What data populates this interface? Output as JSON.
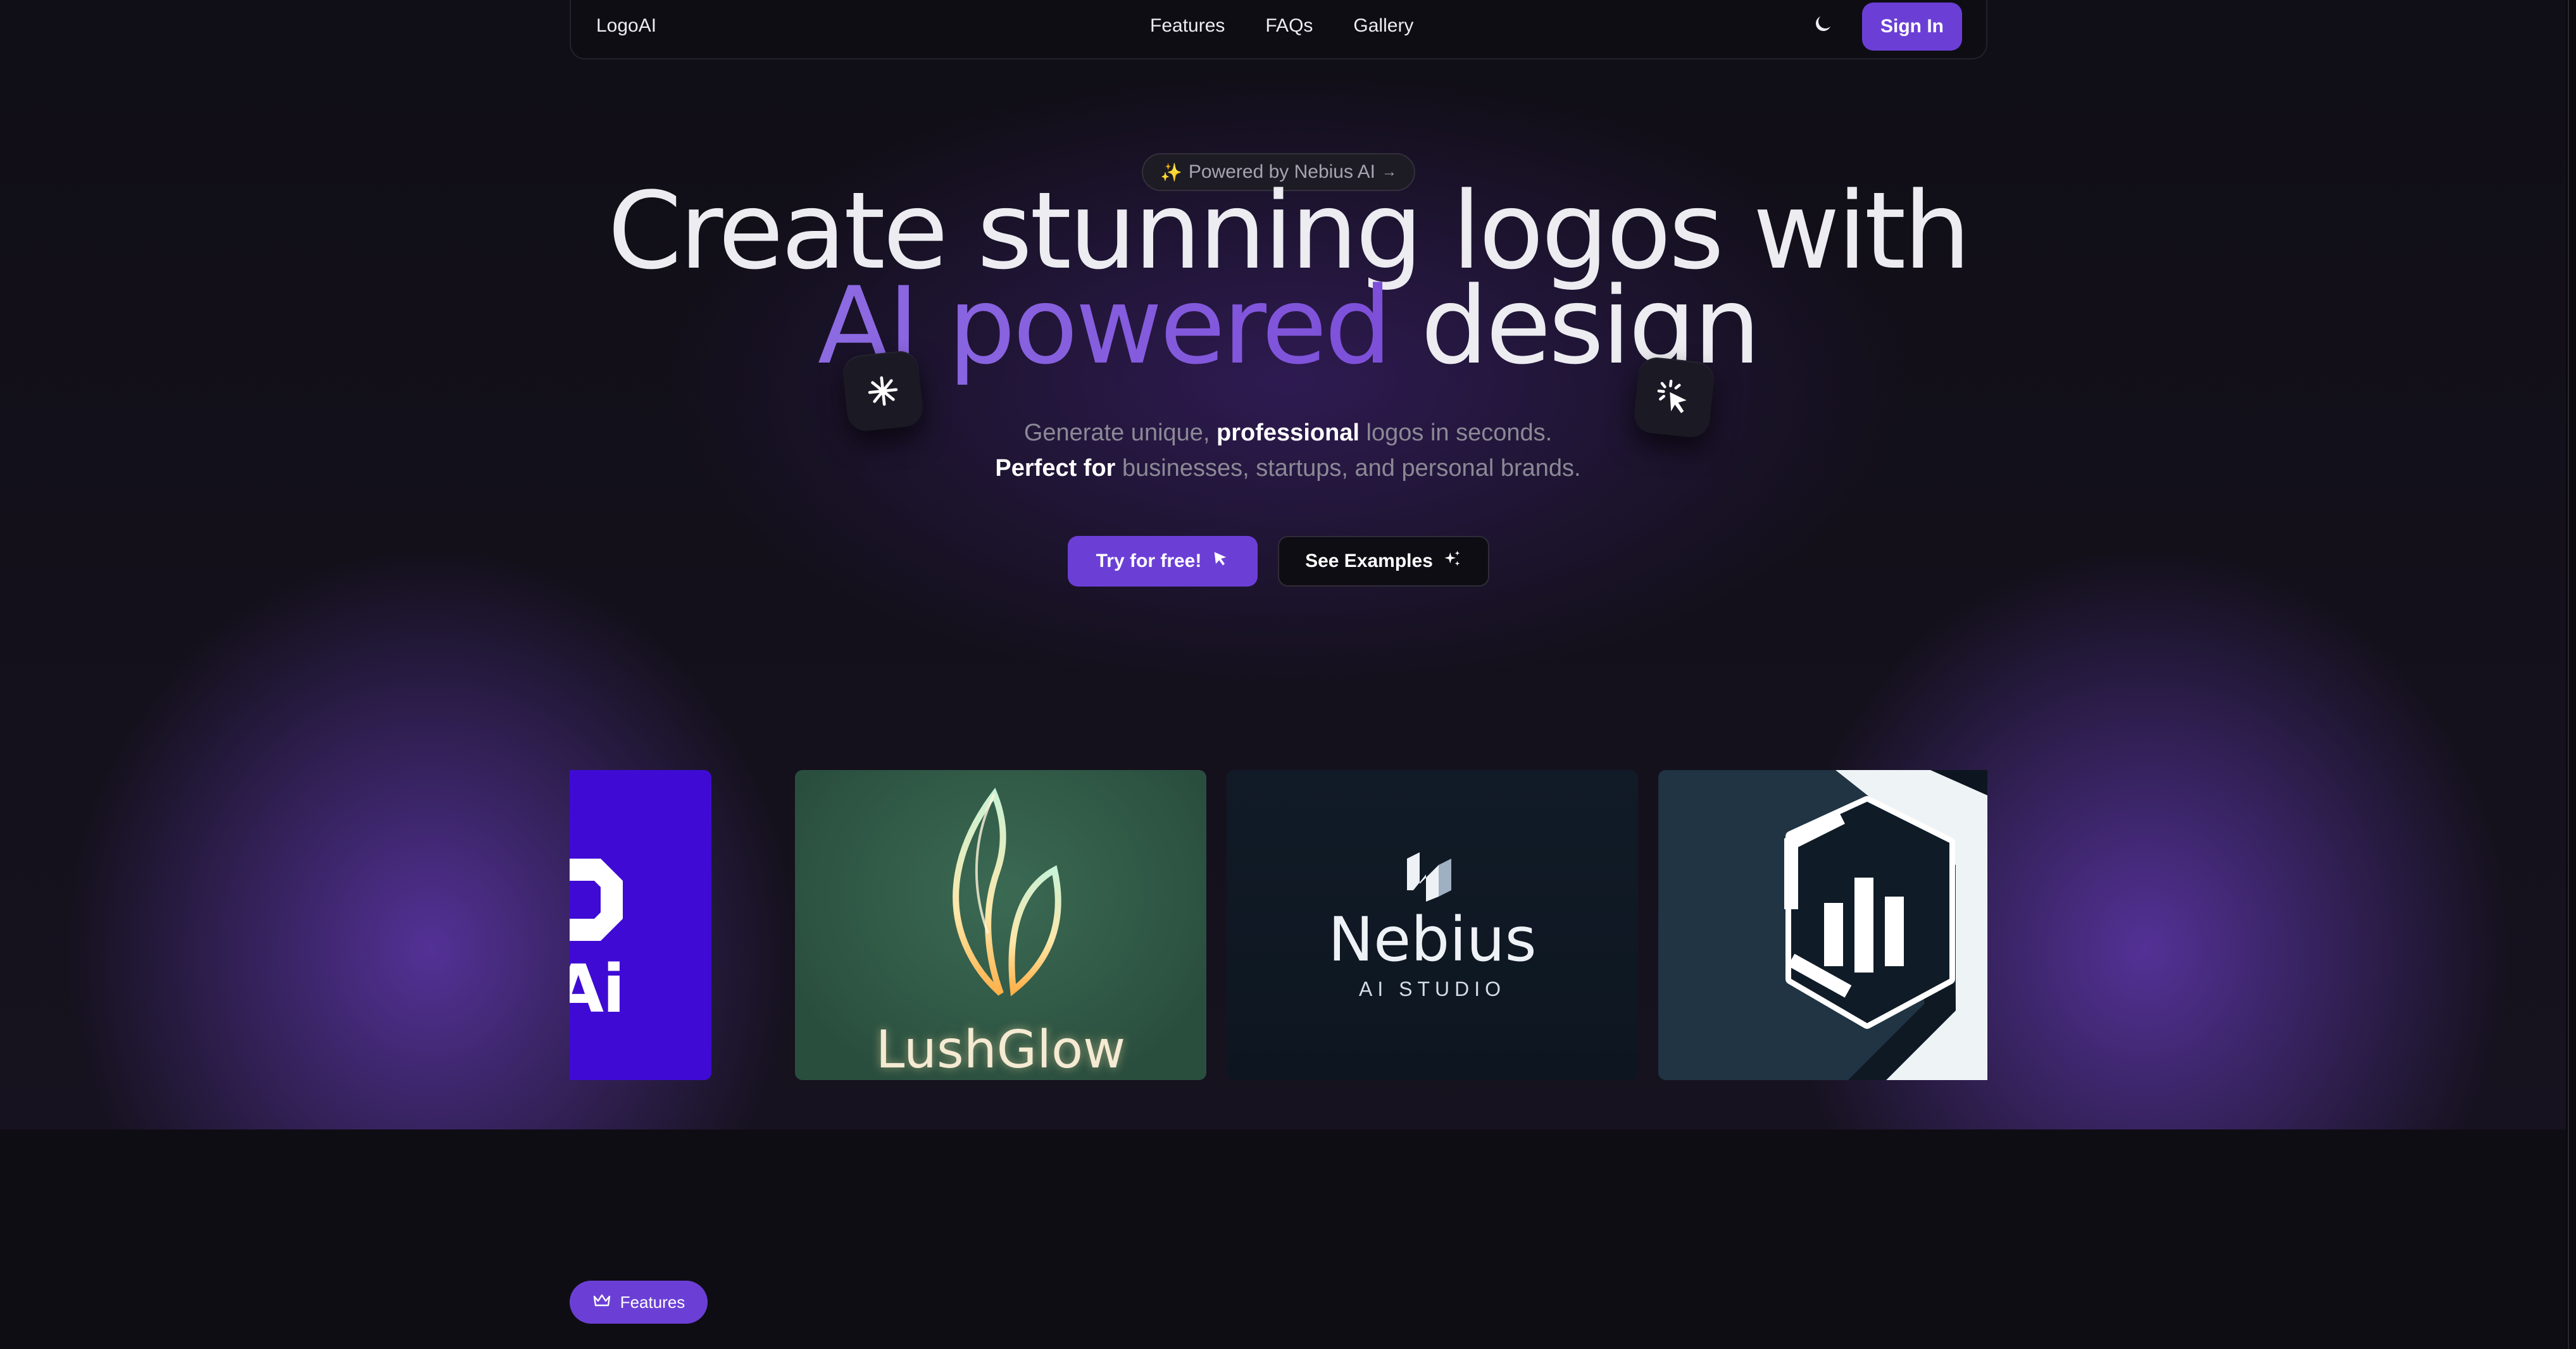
{
  "nav": {
    "brand": "LogoAI",
    "links": [
      "Features",
      "FAQs",
      "Gallery"
    ],
    "theme_toggle_icon": "moon-icon",
    "signin_label": "Sign In"
  },
  "badge": {
    "icon": "sparkle-icon",
    "text": "Powered by Nebius AI",
    "arrow": "→"
  },
  "hero": {
    "headline_line1": "Create stunning logos with",
    "headline_accent": "AI powered",
    "headline_line2_rest": " design",
    "subtitle_part1": "Generate unique, ",
    "subtitle_bold1": "professional",
    "subtitle_part2": " logos in seconds.",
    "subtitle_bold2": "Perfect for",
    "subtitle_part3": " businesses, startups, and personal brands.",
    "float_icon_left": "asterisk-icon",
    "float_icon_right": "cursor-click-icon"
  },
  "actions": {
    "try_label": "Try for free!",
    "try_icon": "cursor-arrow-icon",
    "examples_label": "See Examples",
    "examples_icon": "sparkles-icon"
  },
  "gallery": {
    "cards": [
      {
        "name": "LogoAi",
        "visible_text": "oAi"
      },
      {
        "name": "LushGlow",
        "visible_text": "LushGlow"
      },
      {
        "name": "Nebius",
        "visible_text": "Nebius",
        "subtext": "AI STUDIO"
      },
      {
        "name": "Hexagon chart logo",
        "visible_text": ""
      }
    ]
  },
  "features_section": {
    "pill_label": "Features",
    "pill_icon": "crown-icon"
  },
  "colors": {
    "accent": "#6b3fd6",
    "background": "#0f0d14",
    "headline_gradient_start": "#8d6be2",
    "headline_gradient_end": "#7d4fd9"
  }
}
